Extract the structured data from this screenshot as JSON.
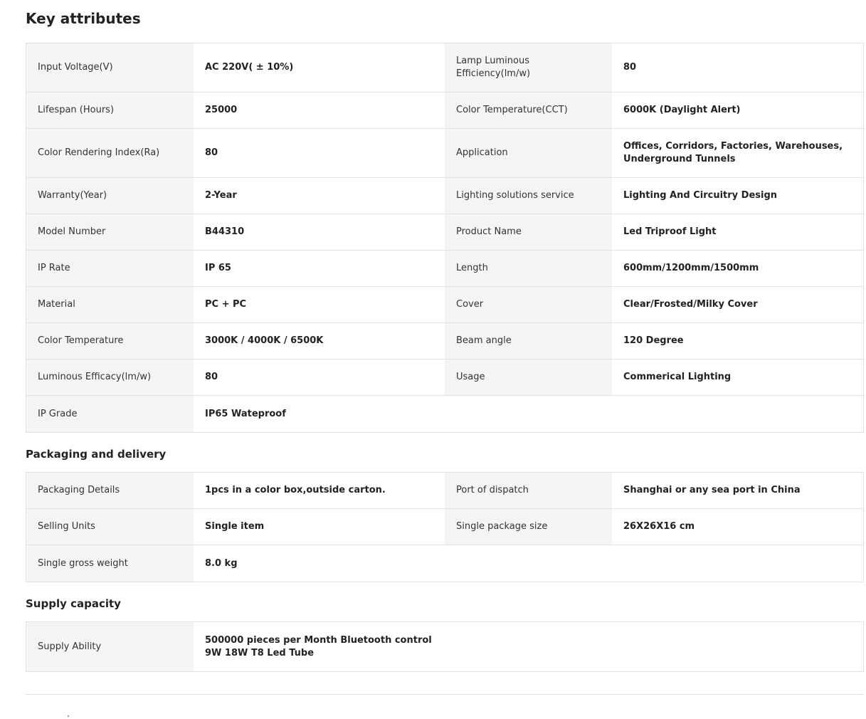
{
  "key_attributes": {
    "title": "Key attributes",
    "rows": [
      [
        {
          "label": "Input Voltage(V)",
          "value": "AC 220V( ± 10%)"
        },
        {
          "label": "Lamp Luminous Efficiency(lm/w)",
          "value": "80"
        }
      ],
      [
        {
          "label": "Lifespan (Hours)",
          "value": "25000"
        },
        {
          "label": "Color Temperature(CCT)",
          "value": "6000K (Daylight Alert)"
        }
      ],
      [
        {
          "label": "Color Rendering Index(Ra)",
          "value": "80"
        },
        {
          "label": "Application",
          "value": "Offices, Corridors, Factories, Warehouses, Underground Tunnels"
        }
      ],
      [
        {
          "label": "Warranty(Year)",
          "value": "2-Year"
        },
        {
          "label": "Lighting solutions service",
          "value": "Lighting And Circuitry Design"
        }
      ],
      [
        {
          "label": "Model Number",
          "value": "B44310"
        },
        {
          "label": "Product Name",
          "value": "Led Triproof Light"
        }
      ],
      [
        {
          "label": "IP Rate",
          "value": "IP 65"
        },
        {
          "label": "Length",
          "value": "600mm/1200mm/1500mm"
        }
      ],
      [
        {
          "label": "Material",
          "value": "PC + PC"
        },
        {
          "label": "Cover",
          "value": "Clear/Frosted/Milky Cover"
        }
      ],
      [
        {
          "label": "Color Temperature",
          "value": "3000K / 4000K / 6500K"
        },
        {
          "label": "Beam angle",
          "value": "120 Degree"
        }
      ],
      [
        {
          "label": "Luminous Efficacy(lm/w)",
          "value": "80"
        },
        {
          "label": "Usage",
          "value": "Commerical Lighting"
        }
      ],
      [
        {
          "label": "IP Grade",
          "value": "IP65 Wateproof"
        }
      ]
    ]
  },
  "packaging": {
    "title": "Packaging and delivery",
    "rows": [
      [
        {
          "label": "Packaging Details",
          "value": "1pcs in a color box,outside carton."
        },
        {
          "label": "Port of dispatch",
          "value": "Shanghai or any sea port in China"
        }
      ],
      [
        {
          "label": "Selling Units",
          "value": "Single item"
        },
        {
          "label": "Single package size",
          "value": "26X26X16 cm"
        }
      ],
      [
        {
          "label": "Single gross weight",
          "value": "8.0 kg"
        }
      ]
    ]
  },
  "supply": {
    "title": "Supply capacity",
    "rows": [
      [
        {
          "label": "Supply Ability",
          "value": "500000 pieces per Month Bluetooth control 9W 18W T8 Led Tube"
        }
      ]
    ]
  }
}
